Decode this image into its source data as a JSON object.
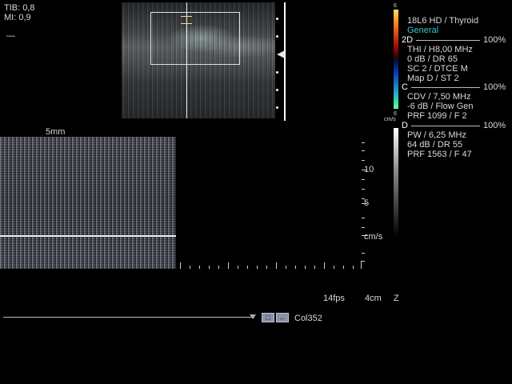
{
  "indices": {
    "tib": "TIB: 0,8",
    "mi": "MI: 0,9",
    "dash": "—"
  },
  "bmode": {
    "scale_label": "5mm"
  },
  "colorbar": {
    "top_value": "6",
    "bottom_value": "6",
    "unit": "cm/s"
  },
  "presets": {
    "probe": "18L6 HD / Thyroid",
    "preset": "General",
    "mode_2d": "2D",
    "gain_2d": "100%",
    "thi": "THI / H8,00 MHz",
    "dr": "0 dB / DR 65",
    "sc": "SC 2 / DTCE M",
    "map": "Map D / ST 2",
    "mode_c": "C",
    "gain_c": "100%",
    "cdv": "CDV / 7,50 MHz",
    "flow": "-6 dB / Flow Gen",
    "prf_c": "PRF 1099 / F 2",
    "mode_d": "D",
    "gain_d": "100%",
    "pw": "PW / 6,25 MHz",
    "pw_dr": "64 dB / DR 55",
    "prf_d": "PRF 1563 / F 47"
  },
  "velocity_axis": {
    "label_10": "10",
    "label_5": "5",
    "unit": "cm/s"
  },
  "status": {
    "fps": "14fps",
    "depth": "4cm",
    "zoom": "Z"
  },
  "cine": {
    "clip_label": "Col352",
    "btn1": "□",
    "btn2": "←"
  },
  "colors": {
    "accent_preset": "#3cc8c8",
    "text": "#d8d8d8"
  }
}
